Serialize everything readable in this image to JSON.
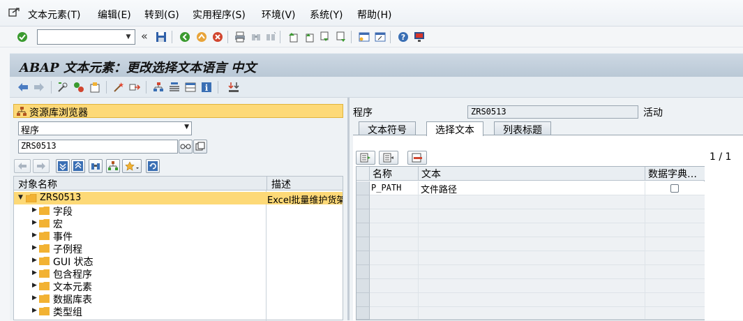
{
  "menubar": {
    "items": [
      "文本元素(T)",
      "编辑(E)",
      "转到(G)",
      "实用程序(S)",
      "环境(V)",
      "系统(Y)",
      "帮助(H)"
    ]
  },
  "std_toolbar": {
    "command_value": "",
    "back_symbol": "«"
  },
  "title": "ABAP 文本元素：更改选择文本语言 中文",
  "repository": {
    "header": "资源库浏览器",
    "object_type": "程序",
    "object_name": "ZRS0513",
    "tree": {
      "col_name": "对象名称",
      "col_desc": "描述",
      "root": {
        "name": "ZRS0513",
        "desc": "Excel批量维护货架"
      },
      "children": [
        "字段",
        "宏",
        "事件",
        "子例程",
        "GUI 状态",
        "包含程序",
        "文本元素",
        "数据库表",
        "类型组"
      ]
    }
  },
  "detail": {
    "program_label": "程序",
    "program_value": "ZRS0513",
    "status": "活动",
    "tabs": [
      "文本符号",
      "选择文本",
      "列表标题"
    ],
    "active_tab": "选择文本",
    "page_indicator": "1 / 1",
    "grid": {
      "headers": [
        "名称",
        "文本",
        "数据字典…"
      ],
      "rows": [
        {
          "name": "P_PATH",
          "text": "文件路径",
          "ddic_ref": false
        }
      ]
    }
  },
  "colors": {
    "accent_orange": "#fdd977",
    "title_bar": "#c3d0dc",
    "folder": "#f2b233",
    "ok_green": "#3a9a2f"
  }
}
